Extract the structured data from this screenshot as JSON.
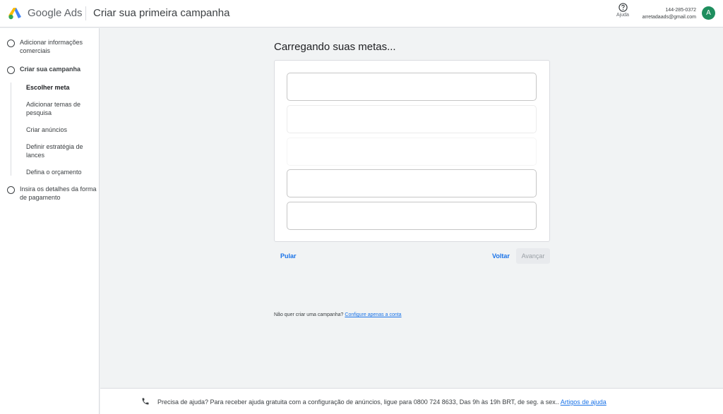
{
  "header": {
    "product_name": "Google Ads",
    "title": "Criar sua primeira campanha",
    "help_label": "Ajuda",
    "account_id": "144-285-0372",
    "account_email": "arretadaads@gmail.com",
    "avatar_letter": "A"
  },
  "sidebar": {
    "steps": [
      {
        "label": "Adicionar informações comerciais"
      },
      {
        "label": "Criar sua campanha"
      },
      {
        "label": "Insira os detalhes da forma de pagamento"
      }
    ],
    "substeps": [
      {
        "label": "Escolher meta"
      },
      {
        "label": "Adicionar temas de pesquisa"
      },
      {
        "label": "Criar anúncios"
      },
      {
        "label": "Definir estratégia de lances"
      },
      {
        "label": "Defina o orçamento"
      }
    ]
  },
  "main": {
    "title": "Carregando suas metas...",
    "skip_label": "Pular",
    "back_label": "Voltar",
    "next_label": "Avançar",
    "no_campaign_text": "Não quer criar uma campanha?",
    "configure_link": "Configure apenas a conta"
  },
  "footer": {
    "help_text": "Precisa de ajuda? Para receber ajuda gratuita com a configuração de anúncios, ligue para 0800 724 8633, Das 9h às 19h BRT, de seg. a sex..",
    "help_link": "Artigos de ajuda"
  },
  "colors": {
    "accent": "#1a73e8",
    "avatar_bg": "#1e8e5e",
    "background": "#f1f3f4"
  },
  "icons": {
    "logo": "google-ads-logo",
    "help": "help-circle-icon",
    "phone": "phone-icon",
    "step": "radio-circle-icon"
  }
}
